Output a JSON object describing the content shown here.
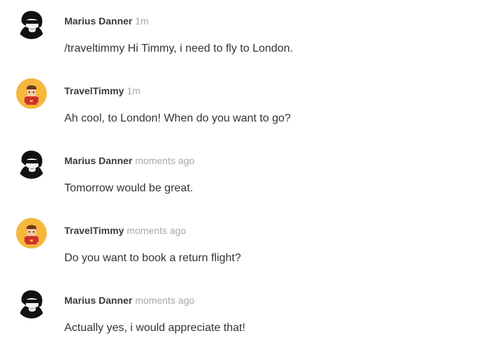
{
  "messages": [
    {
      "author": "Marius Danner",
      "time": "1m",
      "text": "/traveltimmy Hi Timmy, i need to fly to London.",
      "avatar": "user-avatar-icon"
    },
    {
      "author": "TravelTimmy",
      "time": "1m",
      "text": "Ah cool, to London! When do you want to go?",
      "avatar": "bot-avatar-icon"
    },
    {
      "author": "Marius Danner",
      "time": "moments ago",
      "text": "Tomorrow would be great.",
      "avatar": "user-avatar-icon"
    },
    {
      "author": "TravelTimmy",
      "time": "moments ago",
      "text": "Do you want to book a return flight?",
      "avatar": "bot-avatar-icon"
    },
    {
      "author": "Marius Danner",
      "time": "moments ago",
      "text": "Actually yes, i would appreciate that!",
      "avatar": "user-avatar-icon"
    }
  ],
  "colors": {
    "bot_avatar_bg": "#f6b73c",
    "bot_shirt": "#d32f2f",
    "user_avatar_bg": "#1a1a1a",
    "timestamp": "#a8a8a8"
  }
}
